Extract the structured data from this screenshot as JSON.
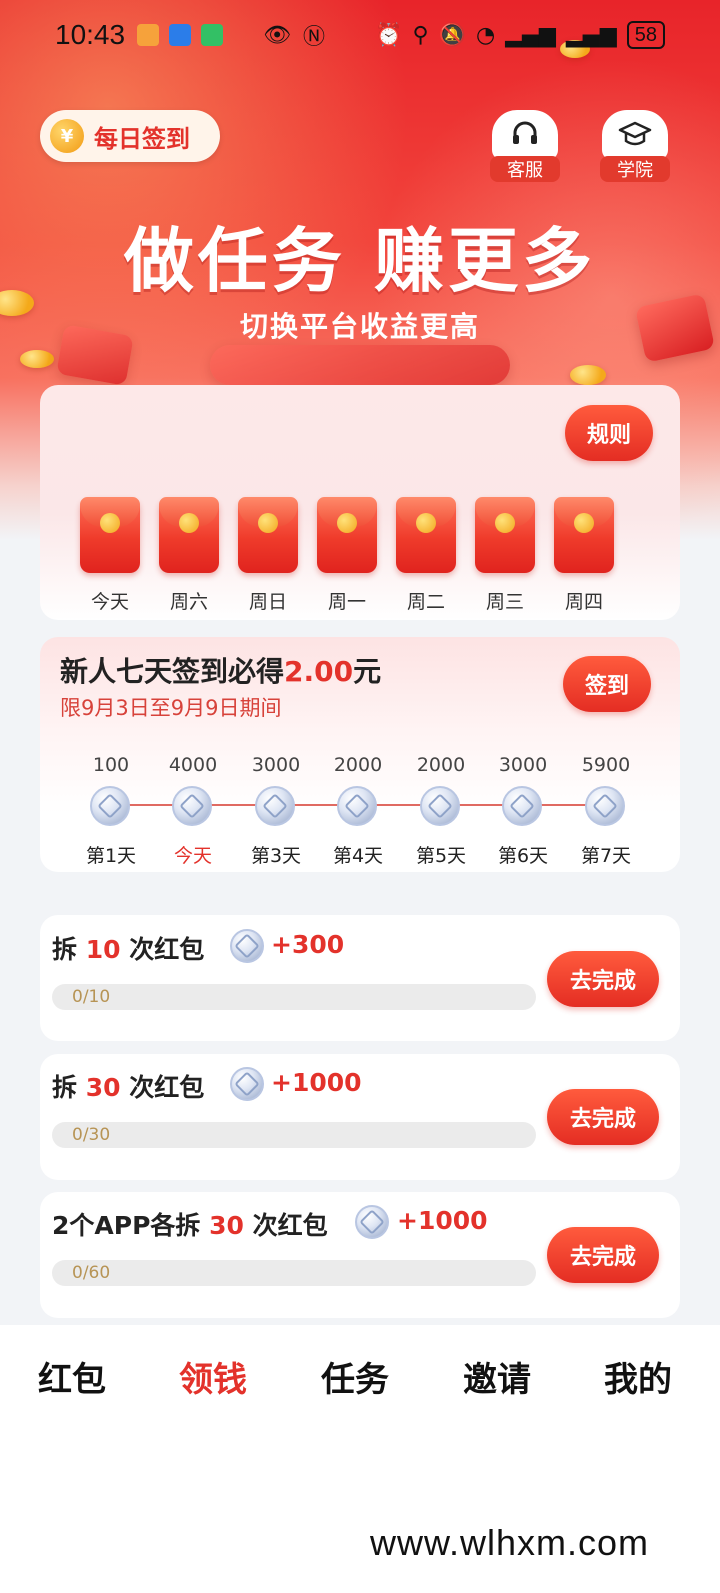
{
  "status_bar": {
    "time": "10:43",
    "battery": "58"
  },
  "header": {
    "daily_checkin": "每日签到",
    "daily_checkin_coin": "¥",
    "service_label": "客服",
    "academy_label": "学院",
    "headline": "做任务 赚更多",
    "subline": "切换平台收益更高"
  },
  "envelopes": {
    "rule_label": "规则",
    "days": [
      "今天",
      "周六",
      "周日",
      "周一",
      "周二",
      "周三",
      "周四"
    ]
  },
  "seven_day": {
    "title_prefix": "新人七天签到必得",
    "title_amount": "2.00",
    "title_suffix": "元",
    "period": "限9月3日至9月9日期间",
    "signin_label": "签到",
    "amounts": [
      "100",
      "4000",
      "3000",
      "2000",
      "2000",
      "3000",
      "5900"
    ],
    "days": [
      "第1天",
      "今天",
      "第3天",
      "第4天",
      "第5天",
      "第6天",
      "第7天"
    ]
  },
  "tasks": [
    {
      "prefix": "拆 ",
      "num": "10",
      "suffix": " 次红包",
      "reward": "+300",
      "progress": "0/10",
      "progress_value": 0,
      "button": "去完成"
    },
    {
      "prefix": "拆 ",
      "num": "30",
      "suffix": " 次红包",
      "reward": "+1000",
      "progress": "0/30",
      "progress_value": 0,
      "button": "去完成"
    },
    {
      "prefix": "2个APP各拆 ",
      "num": "30",
      "suffix": " 次红包",
      "reward": "+1000",
      "progress": "0/60",
      "progress_value": 0,
      "button": "去完成"
    }
  ],
  "bottom_nav": {
    "items": [
      "红包",
      "领钱",
      "任务",
      "邀请",
      "我的"
    ],
    "active_index": 1
  },
  "watermark": "www.wlhxm.com",
  "colors": {
    "accent": "#e3322b",
    "hero_top": "#e8242a"
  }
}
